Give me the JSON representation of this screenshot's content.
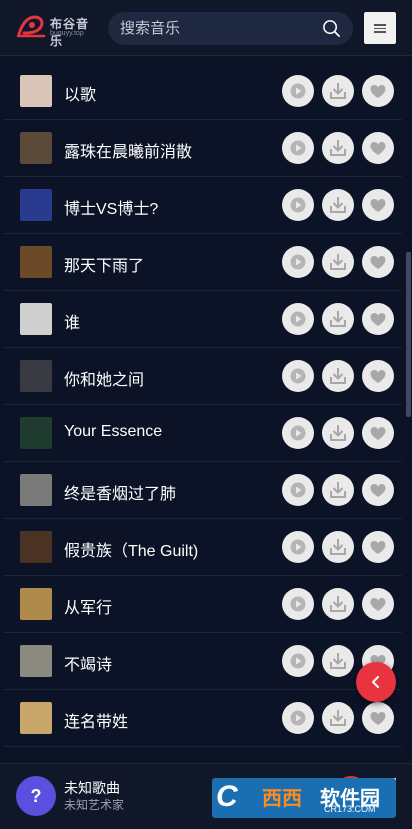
{
  "header": {
    "logo_title": "布谷音乐",
    "logo_subtitle": "buguyy.top",
    "search_placeholder": "搜索音乐",
    "accent_color": "#e8343f"
  },
  "songs": [
    {
      "title": "以歌",
      "cover_color": "#d9c6b8"
    },
    {
      "title": "露珠在晨曦前消散",
      "cover_color": "#5b4a3a"
    },
    {
      "title": "博士VS博士?",
      "cover_color": "#2a3b8f"
    },
    {
      "title": "那天下雨了",
      "cover_color": "#6b4a2a"
    },
    {
      "title": "谁",
      "cover_color": "#cfcfcf"
    },
    {
      "title": "你和她之间",
      "cover_color": "#3a3a42"
    },
    {
      "title": "Your Essence",
      "cover_color": "#1f3a2e"
    },
    {
      "title": "终是香烟过了肺",
      "cover_color": "#7a7a7a"
    },
    {
      "title": "假贵族（The Guilt)",
      "cover_color": "#4a3322"
    },
    {
      "title": "从军行",
      "cover_color": "#b08a4a"
    },
    {
      "title": "不竭诗",
      "cover_color": "#8a8a80"
    },
    {
      "title": "连名带姓",
      "cover_color": "#c9a66a"
    }
  ],
  "actions": {
    "play": "play-icon",
    "download": "download-icon",
    "favorite": "heart-icon"
  },
  "player": {
    "cover_glyph": "?",
    "title": "未知歌曲",
    "artist": "未知艺术家"
  },
  "watermark": {
    "letter": "C",
    "brand_part1": "西西",
    "brand_part2": "软件园",
    "url": "CR173.COM"
  }
}
